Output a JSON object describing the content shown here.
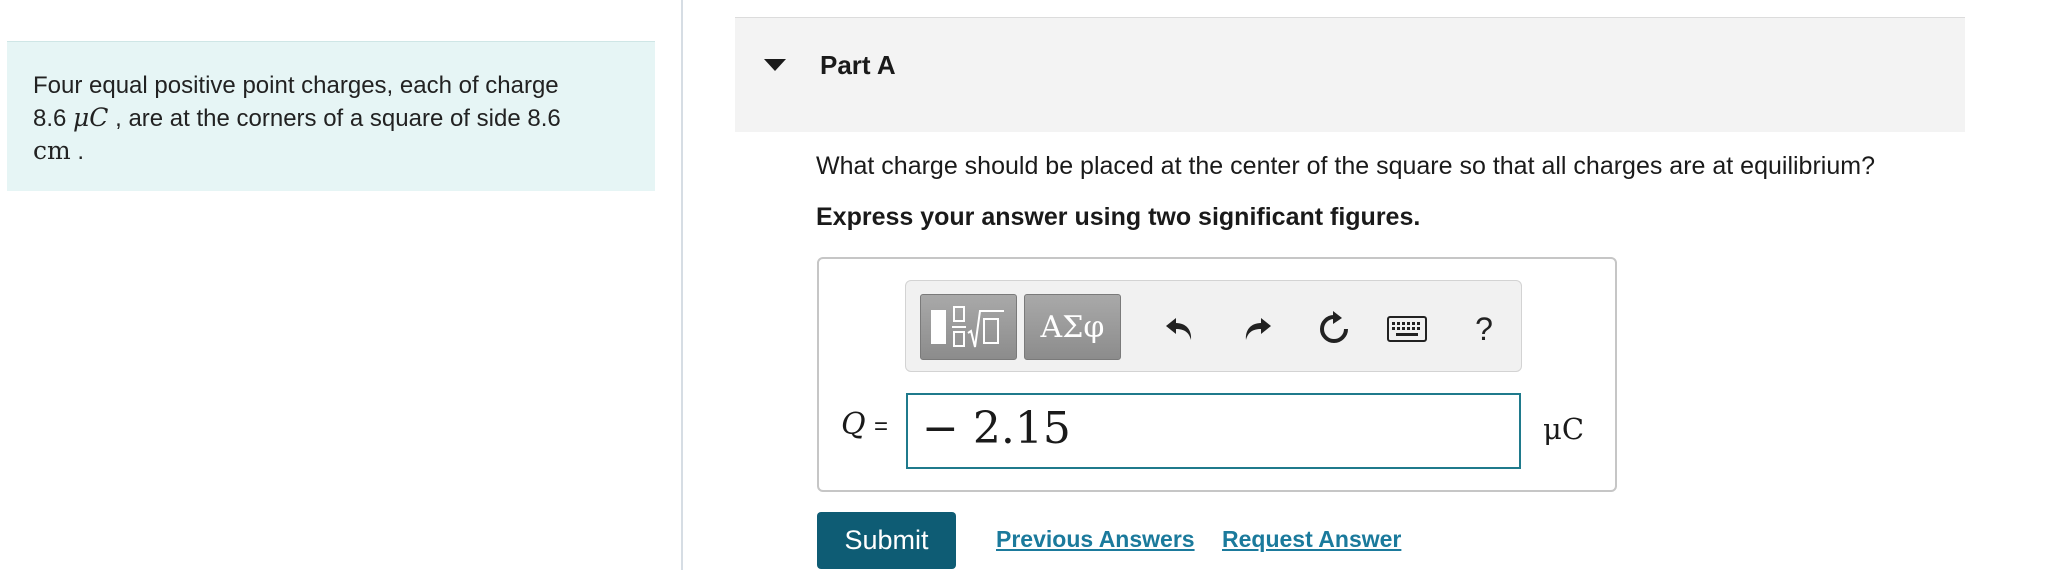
{
  "problem": {
    "text_1": "Four equal positive point charges, each of charge",
    "charge_value": "8.6",
    "charge_unit": "μC",
    "text_2": ", are at the corners of a square of side",
    "side_value": "8.6",
    "side_unit": "cm",
    "text_3": "."
  },
  "part": {
    "title": "Part A",
    "question": "What charge should be placed at the center of the square so that all charges are at equilibrium?",
    "instruction": "Express your answer using two significant figures."
  },
  "toolbar": {
    "greek_label": "ΑΣφ",
    "help_label": "?",
    "icons": [
      "templates-icon",
      "greek-symbols-icon",
      "undo-icon",
      "redo-icon",
      "reset-icon",
      "keyboard-icon",
      "help-icon"
    ]
  },
  "answer": {
    "variable": "Q",
    "equals": "=",
    "value": "− 2.15",
    "unit": "μC"
  },
  "actions": {
    "submit_label": "Submit",
    "previous_answers_label": "Previous Answers",
    "request_answer_label": "Request Answer"
  },
  "colors": {
    "problem_bg": "#e6f5f5",
    "submit_bg": "#0e5c74",
    "link": "#1b7a9c",
    "input_border": "#1f7a8c"
  }
}
